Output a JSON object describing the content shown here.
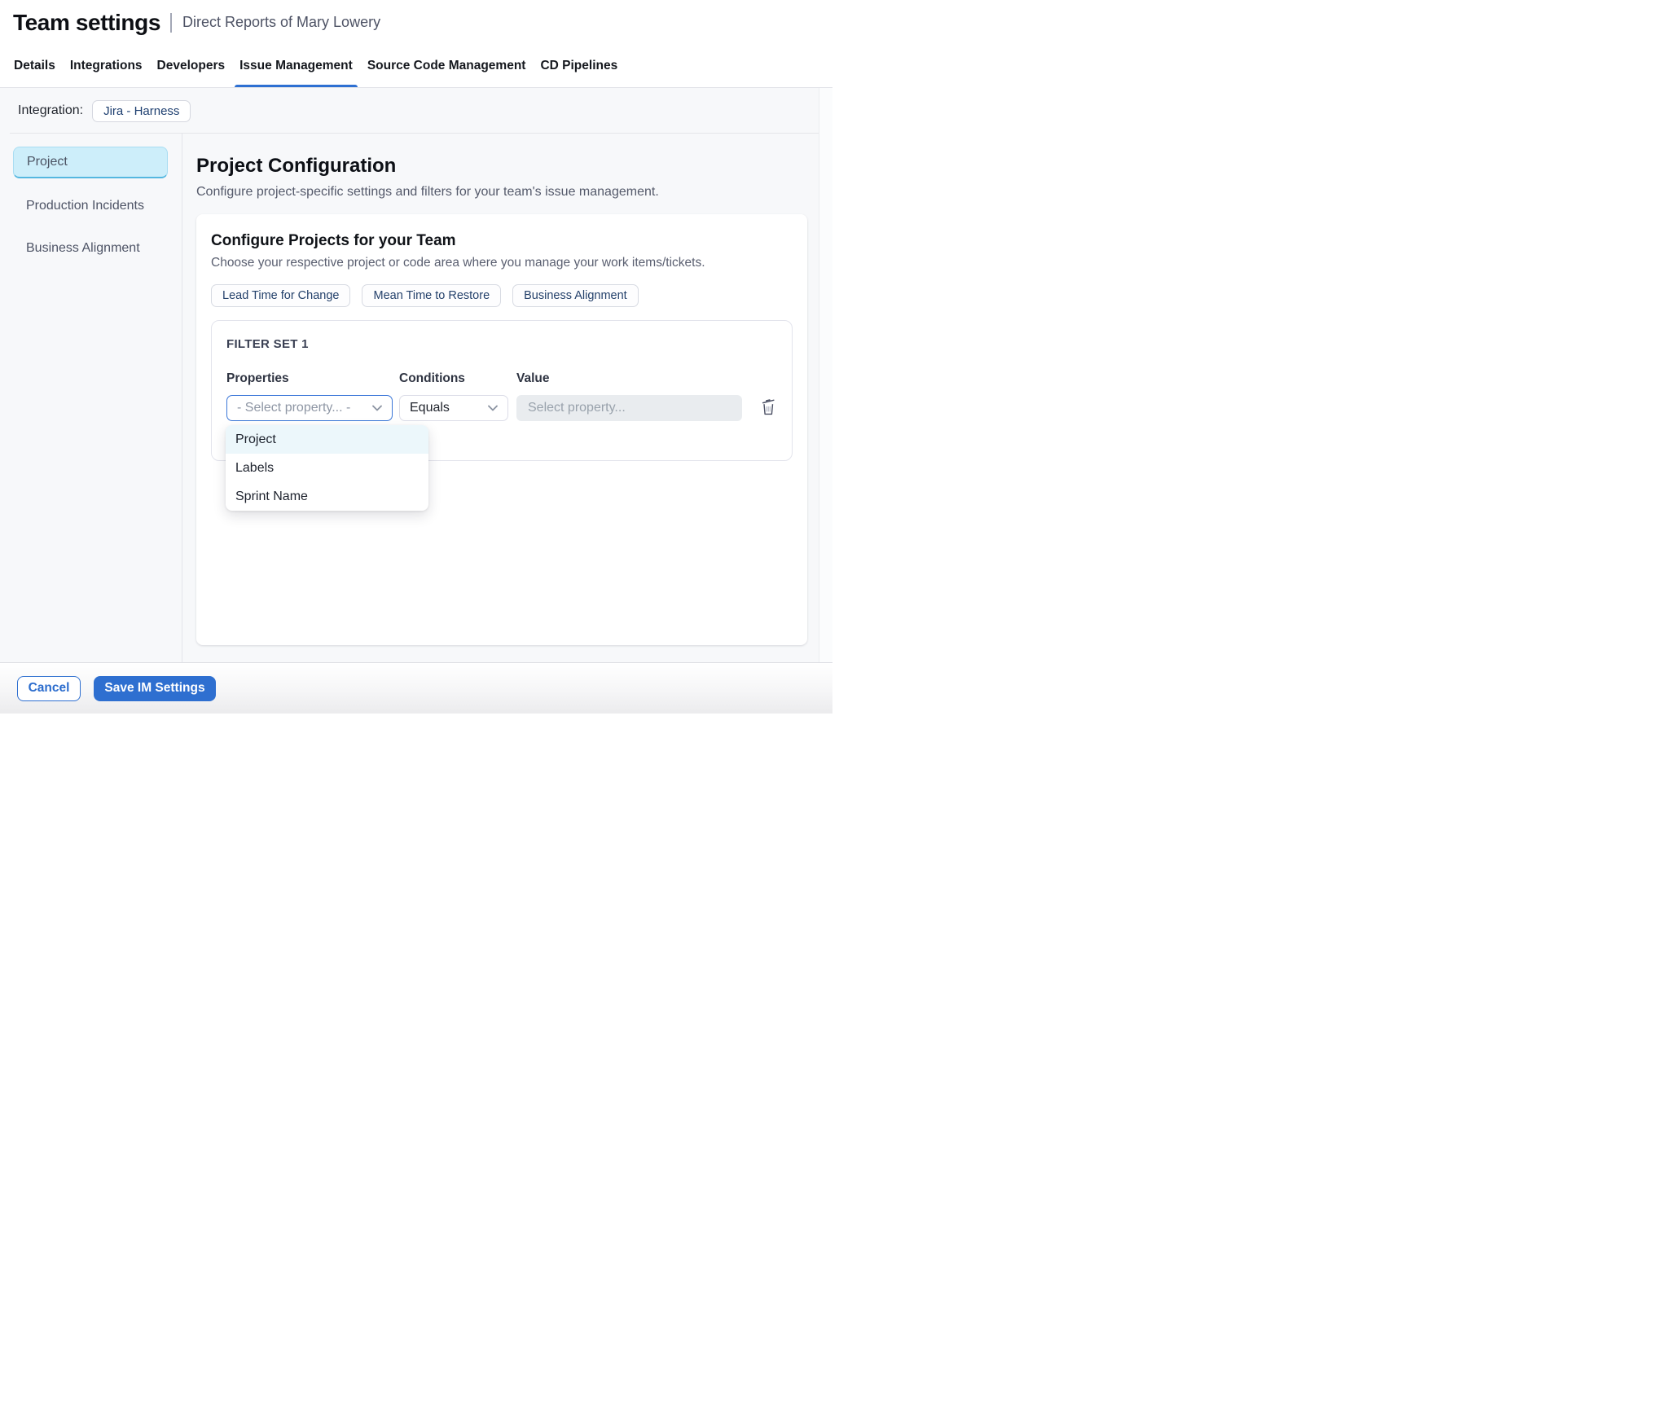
{
  "colors": {
    "accent_blue": "#2e6fd0",
    "tab_underline": "#2e70d2",
    "sidebar_selected_bg": "#cdeefa",
    "sidebar_selected_accent": "#54b7e0",
    "dropdown_highlight_bg": "#ecf7fb",
    "focused_select_border": "#3a76d8",
    "chip_text": "#24416b",
    "content_background": "#f7f8fa"
  },
  "header": {
    "title": "Team settings",
    "subtitle": "Direct Reports of Mary Lowery"
  },
  "tabs": [
    {
      "label": "Details",
      "active": false
    },
    {
      "label": "Integrations",
      "active": false
    },
    {
      "label": "Developers",
      "active": false
    },
    {
      "label": "Issue Management",
      "active": true
    },
    {
      "label": "Source Code Management",
      "active": false
    },
    {
      "label": "CD Pipelines",
      "active": false
    }
  ],
  "integration": {
    "label": "Integration:",
    "value": "Jira - Harness"
  },
  "sidebar": {
    "items": [
      {
        "label": "Project",
        "selected": true
      },
      {
        "label": "Production Incidents",
        "selected": false
      },
      {
        "label": "Business Alignment",
        "selected": false
      }
    ]
  },
  "main": {
    "title": "Project Configuration",
    "description": "Configure project-specific settings and filters for your team's issue management.",
    "card": {
      "title": "Configure Projects for your Team",
      "subtitle": "Choose your respective project or code area where you manage your work items/tickets.",
      "chips": [
        {
          "label": "Lead Time for Change"
        },
        {
          "label": "Mean Time to Restore"
        },
        {
          "label": "Business Alignment"
        }
      ],
      "filter_set": {
        "title": "FILTER SET 1",
        "properties_label": "Properties",
        "conditions_label": "Conditions",
        "value_label": "Value",
        "property_placeholder": "- Select property... -",
        "condition_value": "Equals",
        "value_placeholder": "Select property...",
        "dropdown_options": [
          {
            "label": "Project",
            "highlighted": true
          },
          {
            "label": "Labels",
            "highlighted": false
          },
          {
            "label": "Sprint Name",
            "highlighted": false
          }
        ]
      }
    }
  },
  "footer": {
    "cancel_label": "Cancel",
    "save_label": "Save IM Settings"
  }
}
